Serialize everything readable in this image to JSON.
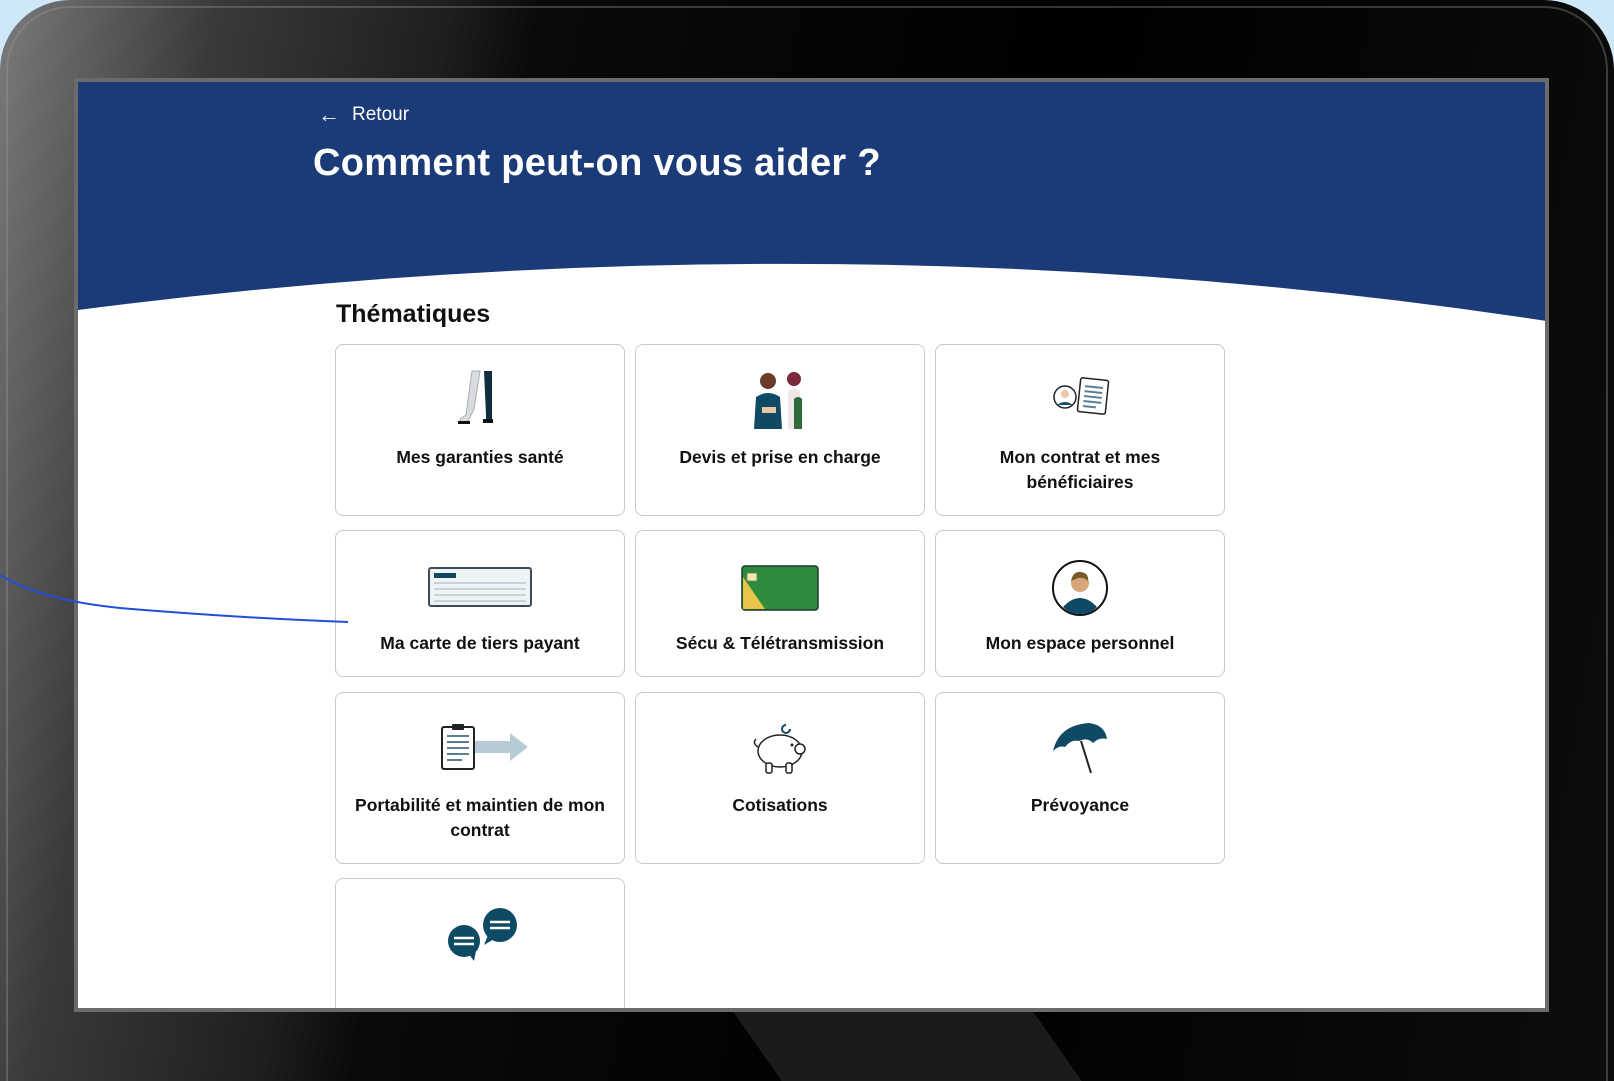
{
  "nav": {
    "back_label": "Retour",
    "back_icon": "arrow-left-icon"
  },
  "page": {
    "title": "Comment peut-on vous aider ?"
  },
  "section": {
    "title": "Thématiques"
  },
  "tiles": [
    {
      "label": "Mes garanties santé",
      "icon": "leg-cast-icon"
    },
    {
      "label": "Devis et prise en charge",
      "icon": "two-people-icon"
    },
    {
      "label": "Mon contrat et mes bénéficiaires",
      "icon": "person-document-icon"
    },
    {
      "label": "Ma carte de tiers payant",
      "icon": "card-icon"
    },
    {
      "label": "Sécu & Télétransmission",
      "icon": "health-card-icon"
    },
    {
      "label": "Mon espace personnel",
      "icon": "avatar-icon"
    },
    {
      "label": "Portabilité et maintien de mon contrat",
      "icon": "clipboard-arrow-icon"
    },
    {
      "label": "Cotisations",
      "icon": "piggy-bank-icon"
    },
    {
      "label": "Prévoyance",
      "icon": "umbrella-icon"
    },
    {
      "label": "",
      "icon": "chat-bubbles-icon"
    }
  ],
  "colors": {
    "brand_navy": "#1b3a78",
    "teal": "#0e4a63",
    "green": "#2e8b3c",
    "yellow": "#e6c54a"
  }
}
